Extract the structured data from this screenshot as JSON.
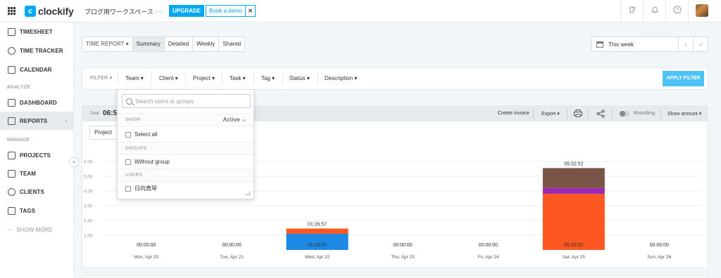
{
  "topbar": {
    "logo_text": "clockify",
    "logo_mark": "c",
    "workspace": "ブログ用ワークスペース",
    "workspace_more": "○○○",
    "upgrade_label": "UPGRADE",
    "demo_label": "Book a demo",
    "demo_close": "✕",
    "icons": [
      "grid-icon",
      "puzzle-icon",
      "bell-icon",
      "help-icon",
      "avatar"
    ]
  },
  "sidebar": {
    "items": [
      {
        "label": "TIMESHEET",
        "icon": "timesheet-icon"
      },
      {
        "label": "TIME TRACKER",
        "icon": "clock-icon"
      },
      {
        "label": "CALENDAR",
        "icon": "calendar-icon"
      },
      {
        "label": "DASHBOARD",
        "icon": "dashboard-icon"
      },
      {
        "label": "REPORTS",
        "icon": "reports-icon",
        "active": true,
        "arrow": "›"
      },
      {
        "label": "PROJECTS",
        "icon": "projects-icon"
      },
      {
        "label": "TEAM",
        "icon": "team-icon"
      },
      {
        "label": "CLIENTS",
        "icon": "clients-icon"
      },
      {
        "label": "TAGS",
        "icon": "tag-icon"
      },
      {
        "label": "SHOW MORE",
        "icon": "chevron-down-icon"
      }
    ],
    "section_analyze": "ANALYZE",
    "section_manage": "MANAGE",
    "collapse": "«"
  },
  "tabs": {
    "time_report": "TIME REPORT ▾",
    "summary": "Summary",
    "detailed": "Detailed",
    "weekly": "Weekly",
    "shared": "Shared"
  },
  "date_range": {
    "label": "This week",
    "prev": "‹",
    "next": "›"
  },
  "filters": {
    "label": "FILTER ▾",
    "team": "Team ▾",
    "client": "Client ▾",
    "project": "Project ▾",
    "task": "Task ▾",
    "tag": "Tag ▾",
    "status": "Status ▾",
    "description": "Description ▾",
    "apply": "APPLY FILTER"
  },
  "report": {
    "total_label": "Total",
    "total_value": "06:59",
    "create_invoice": "Create invoice",
    "export": "Export ▾",
    "rounding": "Rounding",
    "show_amount": "Show amount ▾",
    "group_by": "Project"
  },
  "dropdown": {
    "search_placeholder": "Search users or groups",
    "show_label": "SHOW",
    "show_value": "Active ⌵",
    "select_all": "Select all",
    "groups_label": "GROUPS",
    "without_group": "Without group",
    "users_label": "USERS",
    "user_1": "日向真琴"
  },
  "chart_data": {
    "type": "bar",
    "stacked": true,
    "categories": [
      "Mon, Apr 20",
      "Tue, Apr 21",
      "Wed, Apr 22",
      "Thu, Apr 23",
      "Fri, Apr 24",
      "Sat, Apr 25",
      "Sun, Apr 26"
    ],
    "durations": [
      "00:00:00",
      "00:00:00",
      "01:26:57",
      "00:00:00",
      "00:00:00",
      "05:32:52",
      "00:00:00"
    ],
    "bar_labels": [
      "",
      "",
      "01:26:57",
      "",
      "",
      "05:32:52",
      ""
    ],
    "series": [
      {
        "color": "#1e88e5",
        "values": [
          0,
          0,
          1.1,
          0,
          0,
          0,
          0
        ]
      },
      {
        "color": "#ff5722",
        "values": [
          0,
          0,
          0.35,
          0,
          0,
          3.8,
          0
        ]
      },
      {
        "color": "#9c27b0",
        "values": [
          0,
          0,
          0,
          0,
          0,
          0.4,
          0
        ]
      },
      {
        "color": "#795548",
        "values": [
          0,
          0,
          0,
          0,
          0,
          1.35,
          0
        ]
      }
    ],
    "yticks": [
      "1.0h",
      "2.0h",
      "3.0h",
      "4.0h",
      "5.0h",
      "6.0h"
    ],
    "ylim": [
      0,
      6.0
    ],
    "grid": true
  }
}
